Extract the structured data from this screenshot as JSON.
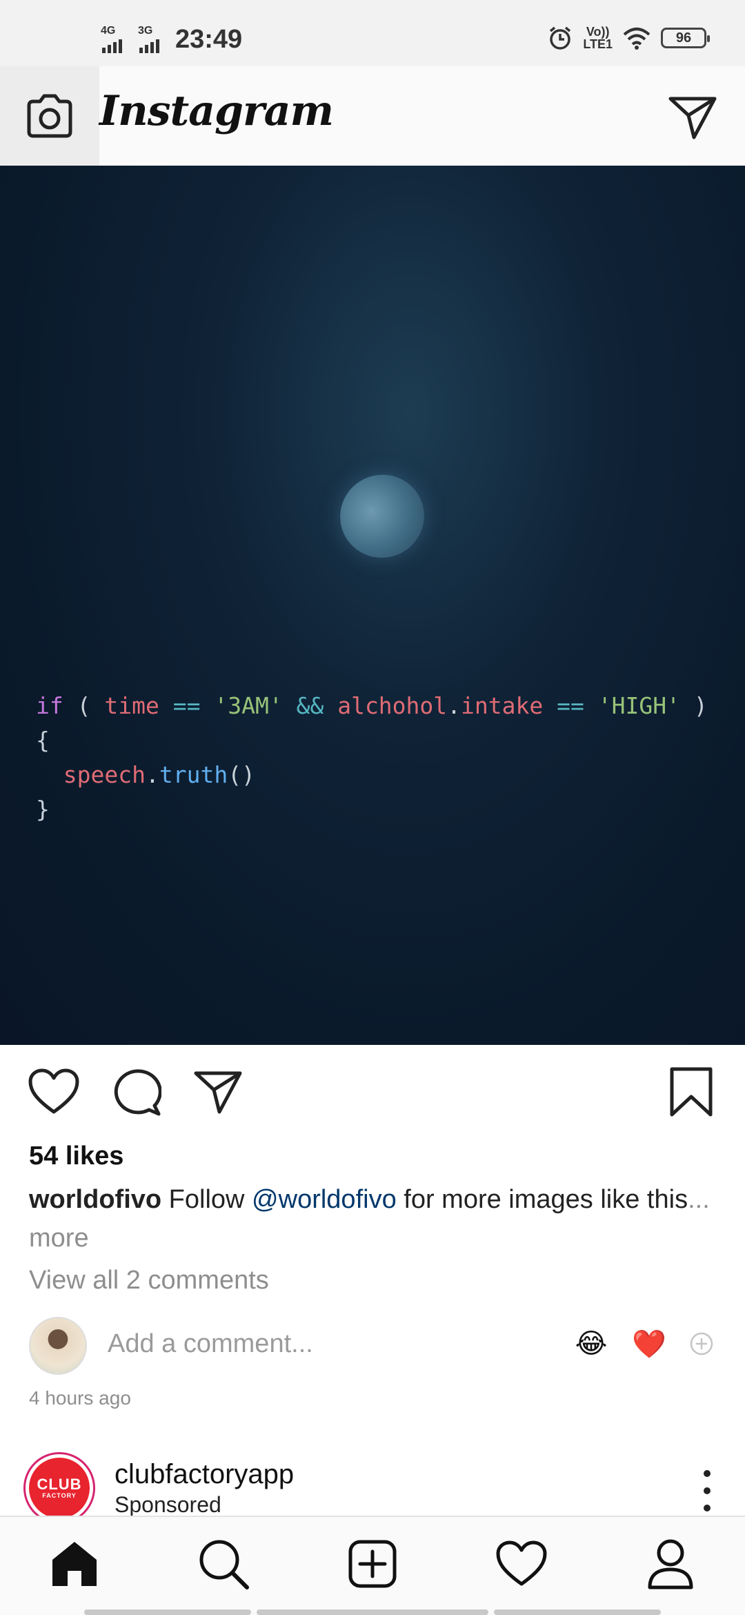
{
  "status_bar": {
    "network1": "4G",
    "network2": "3G",
    "time": "23:49",
    "volte_top": "Vo))",
    "volte_bottom": "LTE1",
    "battery": "96"
  },
  "header": {
    "logo": "Instagram",
    "camera_icon": "camera-icon",
    "direct_icon": "paper-plane-icon"
  },
  "post": {
    "code_lines": [
      "if ( time == '3AM' && alchohol.intake == 'HIGH' )",
      "{",
      "  speech.truth()",
      "}"
    ],
    "likes": "54 likes",
    "caption_user": "worldofivo",
    "caption_text_1": "Follow",
    "caption_mention": "@worldofivo",
    "caption_text_2": "for more images like this",
    "caption_more": "... more",
    "view_comments": "View all 2 comments",
    "comment_placeholder": "Add a comment...",
    "reactions": [
      "😂",
      "❤️"
    ],
    "timestamp": "4 hours ago"
  },
  "next_post": {
    "logo_line1": "CLUB",
    "logo_line2": "FACTORY",
    "username": "clubfactoryapp",
    "sponsored": "Sponsored"
  },
  "bottom_nav": [
    "home-icon",
    "search-icon",
    "add-post-icon",
    "activity-heart-icon",
    "profile-icon"
  ],
  "colors": {
    "mention": "#00376b",
    "muted": "#8e8e8e",
    "reaction_heart": "#e0242b"
  }
}
